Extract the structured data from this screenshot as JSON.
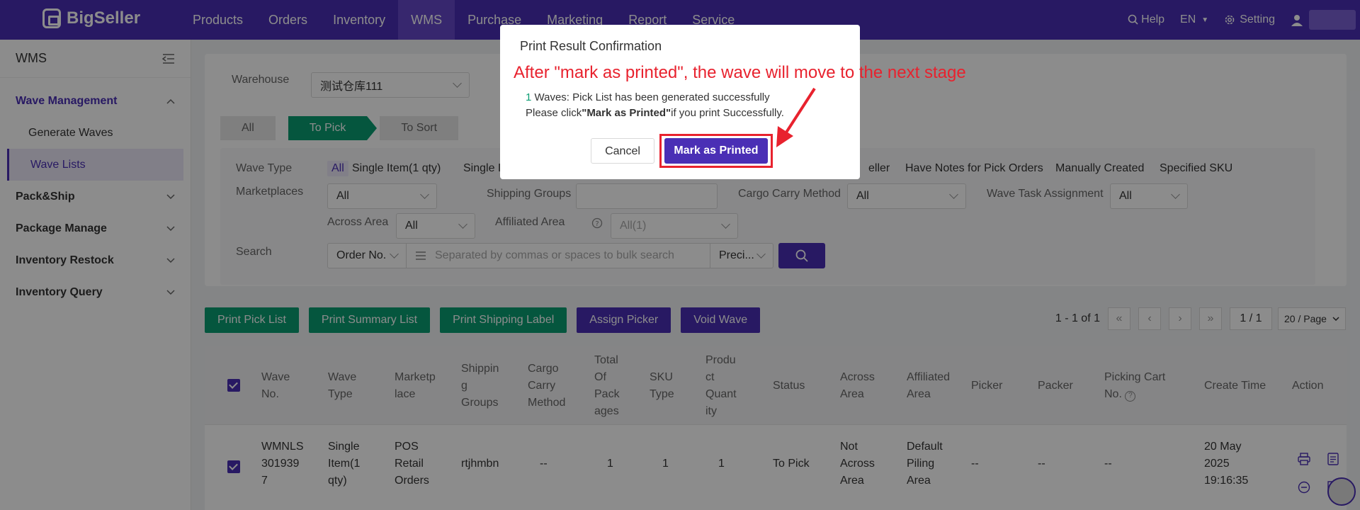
{
  "brand": "BigSeller",
  "nav": {
    "items": [
      "Products",
      "Orders",
      "Inventory",
      "WMS",
      "Purchase",
      "Marketing",
      "Report",
      "Service"
    ],
    "help": "Help",
    "lang": "EN",
    "setting": "Setting"
  },
  "sidebar": {
    "title": "WMS",
    "groups": [
      {
        "label": "Wave Management",
        "open": true,
        "subs": [
          "Generate Waves",
          "Wave Lists"
        ]
      },
      {
        "label": "Pack&Ship"
      },
      {
        "label": "Package Manage"
      },
      {
        "label": "Inventory Restock"
      },
      {
        "label": "Inventory Query"
      }
    ]
  },
  "filters": {
    "warehouse_label": "Warehouse",
    "warehouse_value": "测试仓库111",
    "tabs": [
      "All",
      "To Pick",
      "To Sort"
    ],
    "wave_type_label": "Wave Type",
    "wave_type_options": [
      "All",
      "Single Item(1 qty)",
      "Single It",
      "eller",
      "Have Notes for Pick Orders",
      "Manually Created",
      "Specified SKU"
    ],
    "marketplaces_label": "Marketplaces",
    "marketplaces_value": "All",
    "shipping_groups_label": "Shipping Groups",
    "cargo_label": "Cargo Carry Method",
    "cargo_value": "All",
    "task_label": "Wave Task Assignment",
    "task_value": "All",
    "across_label": "Across Area",
    "across_value": "All",
    "affiliated_label": "Affiliated Area",
    "affiliated_value": "All(1)",
    "search_label": "Search",
    "search_field": "Order No.",
    "search_placeholder": "Separated by commas or spaces to bulk search",
    "search_mode": "Preci..."
  },
  "actions": [
    "Print Pick List",
    "Print Summary List",
    "Print Shipping Label",
    "Assign Picker",
    "Void Wave"
  ],
  "pager": {
    "range": "1 - 1 of 1",
    "page": "1 / 1",
    "size": "20 / Page"
  },
  "table": {
    "headers": {
      "wave_no": [
        "Wave",
        "No."
      ],
      "wave_type": [
        "Wave",
        "Type"
      ],
      "marketplace": [
        "Marketp",
        "lace"
      ],
      "shipping": [
        "Shippin",
        "g",
        "Groups"
      ],
      "cargo": [
        "Cargo",
        "Carry",
        "Method"
      ],
      "total": [
        "Total",
        "Of",
        "Pack",
        "ages"
      ],
      "sku_type": [
        "SKU",
        "Type"
      ],
      "product_qty": [
        "Produ",
        "ct",
        "Quant",
        "ity"
      ],
      "status": [
        "Status"
      ],
      "across": [
        "Across",
        "Area"
      ],
      "affiliated": [
        "Affiliated",
        "Area"
      ],
      "picker": [
        "Picker"
      ],
      "packer": [
        "Packer"
      ],
      "cart": [
        "Picking Cart",
        "No."
      ],
      "create_time": [
        "Create Time"
      ],
      "action": [
        "Action"
      ]
    },
    "row": {
      "wave_no": [
        "WMNLS",
        "301939",
        "7"
      ],
      "wave_type": [
        "Single",
        "Item(1",
        "qty)"
      ],
      "marketplace": [
        "POS",
        "Retail",
        "Orders"
      ],
      "shipping": "rtjhmbn",
      "cargo": "--",
      "total": "1",
      "sku_type": "1",
      "product_qty": "1",
      "status": "To Pick",
      "across": [
        "Not",
        "Across",
        "Area"
      ],
      "affiliated": [
        "Default",
        "Piling",
        "Area"
      ],
      "picker": "--",
      "packer": "--",
      "cart": "--",
      "create_time": [
        "20 May",
        "2025",
        "19:16:35"
      ]
    }
  },
  "modal": {
    "title": "Print Result Confirmation",
    "annotation": "After \"mark as printed\", the wave will move to the next stage",
    "count": "1",
    "line1_rest": " Waves: Pick List has been generated successfully",
    "line2_pre": "Please click",
    "line2_bold": "\"Mark as Printed\"",
    "line2_post": "if you print Successfully.",
    "cancel": "Cancel",
    "confirm": "Mark as Printed"
  },
  "colors": {
    "brand_purple": "#4a2fb5",
    "green": "#0a9d72",
    "annotation_red": "#e8222e"
  }
}
